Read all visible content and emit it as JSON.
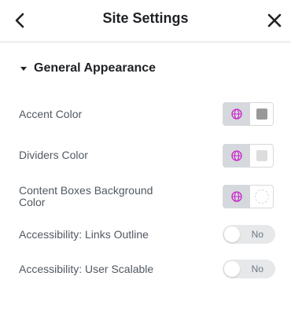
{
  "header": {
    "title": "Site Settings",
    "back_icon": "chevron-left-icon",
    "close_icon": "close-icon"
  },
  "section": {
    "title": "General Appearance",
    "icon": "caret-down-icon"
  },
  "settings": {
    "accent_color": {
      "label": "Accent Color",
      "swatch_color": "#999999"
    },
    "dividers_color": {
      "label": "Dividers Color",
      "swatch_color": "#dddddd"
    },
    "content_boxes_bg": {
      "label_line1": "Content Boxes Background",
      "label_line2": "Color",
      "swatch_color": ""
    },
    "links_outline": {
      "label": "Accessibility: Links Outline",
      "toggle_text": "No"
    },
    "user_scalable": {
      "label": "Accessibility: User Scalable",
      "toggle_text": "No"
    }
  },
  "colors": {
    "globe_icon": "#cc22cc",
    "toggle_bg": "#e6e8ea",
    "global_btn_bg": "#d5d8dc"
  }
}
